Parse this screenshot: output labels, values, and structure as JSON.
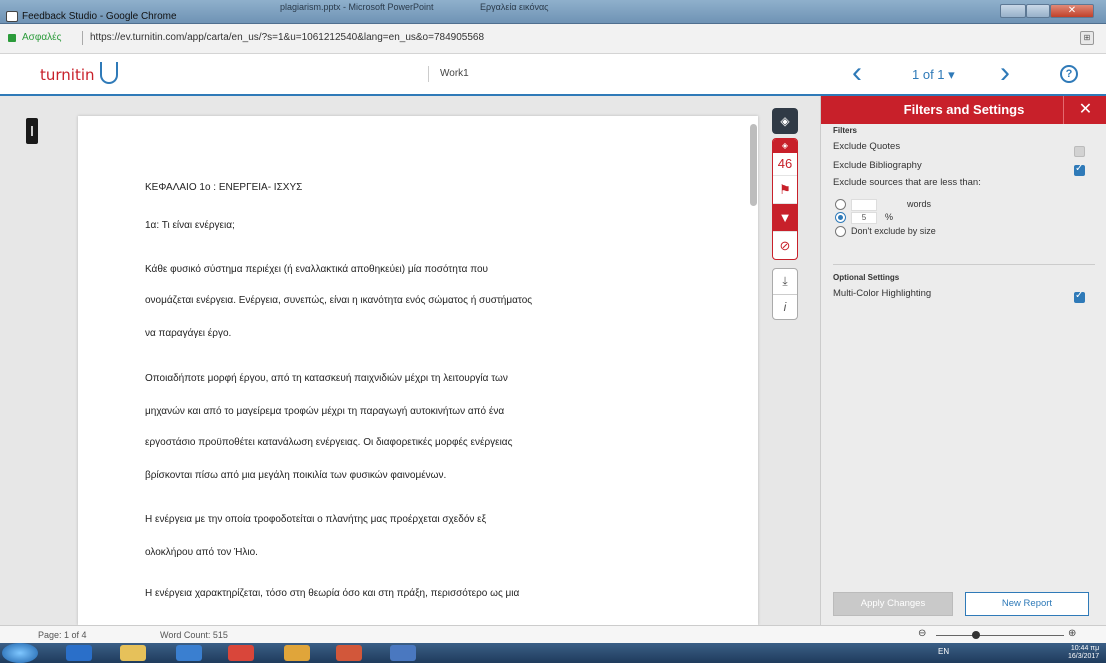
{
  "window": {
    "ppt_title": "plagiarism.pptx - Microsoft PowerPoint",
    "ppt_title2": "Εργαλεία εικόνας",
    "title": "Feedback Studio - Google Chrome"
  },
  "address_bar": {
    "secure_label": "Ασφαλές",
    "url": "https://ev.turnitin.com/app/carta/en_us/?s=1&u=1061212540&lang=en_us&o=784905568"
  },
  "header": {
    "logo": "turnitin",
    "work_title": "Work1",
    "page_indicator": "1 of 1 ▾",
    "prev_icon": "‹",
    "next_icon": "›",
    "help_icon": "?"
  },
  "toolbar": {
    "match_count": "46",
    "icons": [
      "layers-icon",
      "stack-icon",
      "flag-icon",
      "filter-icon",
      "exclude-icon",
      "download-icon",
      "info-icon"
    ]
  },
  "document": {
    "lines": [
      "ΚΕΦΑΛΑΙΟ 1ο : ΕΝΕΡΓΕΙΑ- ΙΣΧΥΣ",
      "1α: Τι είναι ενέργεια;",
      "Κάθε φυσικό σύστημα περιέχει (ή εναλλακτικά αποθηκεύει) μία ποσότητα που",
      "ονομάζεται ενέργεια. Ενέργεια, συνεπώς, είναι η ικανότητα ενός σώματος ή συστήματος",
      "να παραγάγει έργο.",
      "Οποιαδήποτε μορφή έργου, από τη κατασκευή παιχνιδιών μέχρι τη λειτουργία των",
      "μηχανών και από το μαγείρεμα τροφών μέχρι τη παραγωγή αυτοκινήτων από ένα",
      "εργοστάσιο προϋποθέτει κατανάλωση ενέργειας. Οι διαφορετικές  μορφές ενέργειας",
      "βρίσκονται πίσω από μια μεγάλη ποικιλία των φυσικών φαινομένων.",
      "Η ενέργεια με την οποία τροφοδοτείται ο πλανήτης μας προέρχεται σχεδόν εξ",
      "ολοκλήρου από τον Ήλιο.",
      "Η ενέργεια χαρακτηρίζεται, τόσο στη θεωρία όσο και στη πράξη, περισσότερο ως μια"
    ]
  },
  "panel": {
    "title": "Filters and Settings",
    "close": "✕",
    "filters_heading": "Filters",
    "exclude_quotes": "Exclude Quotes",
    "exclude_bibliography": "Exclude Bibliography",
    "exclude_small": "Exclude sources that are less than:",
    "words_label": "words",
    "percent_value": "5",
    "percent_label": "%",
    "dont_exclude": "Don't exclude by size",
    "optional_heading": "Optional Settings",
    "multicolor": "Multi-Color Highlighting",
    "apply_button": "Apply Changes",
    "new_report_button": "New Report"
  },
  "status_bar": {
    "page": "Page: 1 of 4",
    "word_count": "Word Count: 515",
    "zoom_out": "⊖",
    "zoom_in": "⊕"
  },
  "taskbar": {
    "lang": "EN",
    "time": "10:44 πμ",
    "date": "16/3/2017"
  }
}
